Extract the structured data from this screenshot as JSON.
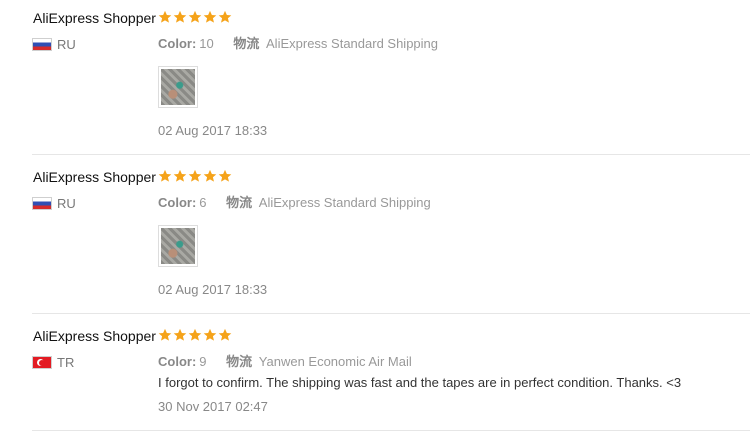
{
  "reviews": [
    {
      "user": "AliExpress Shopper",
      "rating": 5,
      "country": "RU",
      "color_label": "Color:",
      "color_value": "10",
      "shipping_label": "物流",
      "shipping_value": "AliExpress Standard Shipping",
      "has_photo": true,
      "text": "",
      "date": "02 Aug 2017 18:33"
    },
    {
      "user": "AliExpress Shopper",
      "rating": 5,
      "country": "RU",
      "color_label": "Color:",
      "color_value": "6",
      "shipping_label": "物流",
      "shipping_value": "AliExpress Standard Shipping",
      "has_photo": true,
      "text": "",
      "date": "02 Aug 2017 18:33"
    },
    {
      "user": "AliExpress Shopper",
      "rating": 5,
      "country": "TR",
      "color_label": "Color:",
      "color_value": "9",
      "shipping_label": "物流",
      "shipping_value": "Yanwen Economic Air Mail",
      "has_photo": false,
      "text": "I forgot to confirm. The shipping was fast and the tapes are in perfect condition. Thanks. <3",
      "date": "30 Nov 2017 02:47"
    }
  ],
  "colors": {
    "star": "#f5a31a",
    "separator": "#e6e6e6",
    "meta": "#999999"
  }
}
